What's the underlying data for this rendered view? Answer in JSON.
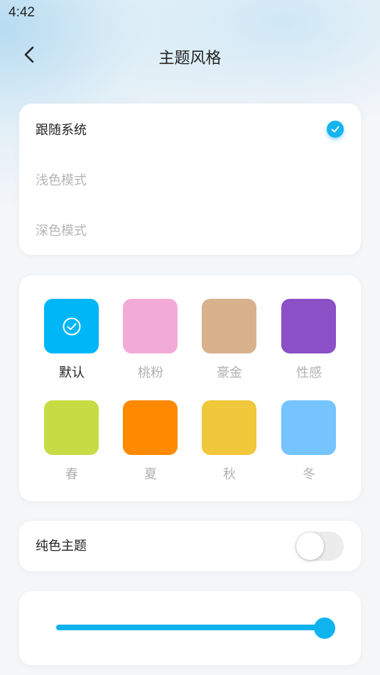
{
  "status_bar": {
    "time": "4:42"
  },
  "header": {
    "title": "主题风格",
    "back_icon": "chevron-left-icon"
  },
  "mode_options": [
    {
      "label": "跟随系统",
      "selected": true
    },
    {
      "label": "浅色模式",
      "selected": false
    },
    {
      "label": "深色模式",
      "selected": false
    }
  ],
  "colors": [
    {
      "label": "默认",
      "color": "#00b6f7",
      "selected": true
    },
    {
      "label": "桃粉",
      "color": "#f2aad6",
      "selected": false
    },
    {
      "label": "豪金",
      "color": "#d7b28d",
      "selected": false
    },
    {
      "label": "性感",
      "color": "#8b4fc6",
      "selected": false
    },
    {
      "label": "春",
      "color": "#c6dc44",
      "selected": false
    },
    {
      "label": "夏",
      "color": "#ff8a00",
      "selected": false
    },
    {
      "label": "秋",
      "color": "#f1c73b",
      "selected": false
    },
    {
      "label": "冬",
      "color": "#75c3ff",
      "selected": false
    }
  ],
  "pure_theme": {
    "label": "纯色主题",
    "enabled": false
  },
  "slider": {
    "value": 1.0,
    "accent": "#0fb3ee"
  },
  "accent_color": "#14b4ef"
}
